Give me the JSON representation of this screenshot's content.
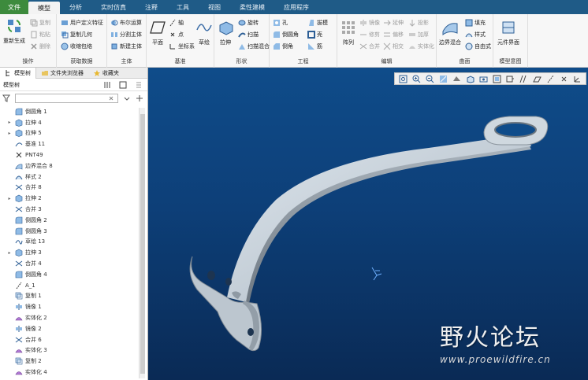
{
  "menu": [
    "文件",
    "模型",
    "分析",
    "实时仿真",
    "注释",
    "工具",
    "视图",
    "柔性建模",
    "应用程序"
  ],
  "ribbon": {
    "operations": {
      "regenerate": "重新生成",
      "copy": "复制",
      "paste": "粘贴",
      "delete": "删除",
      "label": "操作"
    },
    "get_data": {
      "udf": "用户定义特征",
      "copy_geom": "复制几何",
      "shrinkwrap": "收缩包络",
      "label": "获取数据"
    },
    "body": {
      "boolean": "布尔运算",
      "split": "分割主体",
      "new_body": "新建主体",
      "label": "主体"
    },
    "datum": {
      "plane": "平面",
      "axis": "轴",
      "point": "点",
      "csys": "坐标系",
      "sketch": "草绘",
      "label": "基准"
    },
    "shapes": {
      "extrude": "拉伸",
      "revolve": "旋转",
      "sweep": "扫描",
      "swept_blend": "扫描混合",
      "label": "形状"
    },
    "engineering": {
      "hole": "孔",
      "round": "倒圆角",
      "chamfer": "倒角",
      "draft": "拔模",
      "shell": "壳",
      "rib": "筋",
      "label": "工程"
    },
    "editing": {
      "pattern": "阵列",
      "mirror": "镜像",
      "trim": "修剪",
      "merge": "合并",
      "extend": "延伸",
      "offset": "偏移",
      "intersect": "相交",
      "thicken": "加厚",
      "project": "投影",
      "solidify": "实体化",
      "label": "编辑"
    },
    "surfaces": {
      "boundary_blend": "边界混合",
      "fill": "填充",
      "style": "样式",
      "freestyle": "自由式",
      "label": "曲面"
    },
    "model_intent": {
      "component_interface": "元件界面",
      "label": "模型意图"
    }
  },
  "panel": {
    "tabs": [
      "模型树",
      "文件夹浏览器",
      "收藏夹"
    ],
    "tree_title": "模型树",
    "search_placeholder": ""
  },
  "tree": [
    {
      "label": "倒圆角 1",
      "icon": "round-icon",
      "expandable": false
    },
    {
      "label": "拉伸 4",
      "icon": "extrude-icon",
      "expandable": true
    },
    {
      "label": "拉伸 5",
      "icon": "extrude-icon",
      "expandable": true
    },
    {
      "label": "基准 11",
      "icon": "datum-icon",
      "expandable": false
    },
    {
      "label": "PNT49",
      "icon": "point-icon",
      "expandable": false
    },
    {
      "label": "边界混合 8",
      "icon": "boundary-blend-icon",
      "expandable": false
    },
    {
      "label": "样式 2",
      "icon": "style-icon",
      "expandable": false
    },
    {
      "label": "合并 8",
      "icon": "merge-icon",
      "expandable": false
    },
    {
      "label": "拉伸 2",
      "icon": "extrude-icon",
      "expandable": true
    },
    {
      "label": "合并 3",
      "icon": "merge-icon",
      "expandable": false
    },
    {
      "label": "倒圆角 2",
      "icon": "round-icon",
      "expandable": false
    },
    {
      "label": "倒圆角 3",
      "icon": "round-icon",
      "expandable": false
    },
    {
      "label": "草绘 13",
      "icon": "sketch-icon",
      "expandable": false
    },
    {
      "label": "拉伸 3",
      "icon": "extrude-icon",
      "expandable": true
    },
    {
      "label": "合并 4",
      "icon": "merge-icon",
      "expandable": false
    },
    {
      "label": "倒圆角 4",
      "icon": "round-icon",
      "expandable": false
    },
    {
      "label": "A_1",
      "icon": "axis-icon",
      "expandable": false
    },
    {
      "label": "复制 1",
      "icon": "copy-icon",
      "expandable": false
    },
    {
      "label": "镜像 1",
      "icon": "mirror-icon",
      "expandable": false
    },
    {
      "label": "实体化 2",
      "icon": "solidify-icon",
      "expandable": false
    },
    {
      "label": "镜像 2",
      "icon": "mirror-icon",
      "expandable": false
    },
    {
      "label": "合并 6",
      "icon": "merge-icon",
      "expandable": false
    },
    {
      "label": "实体化 3",
      "icon": "solidify-icon",
      "expandable": false
    },
    {
      "label": "复制 2",
      "icon": "copy-icon",
      "expandable": false
    },
    {
      "label": "实体化 4",
      "icon": "solidify-icon",
      "expandable": false
    }
  ],
  "watermark": {
    "title": "野火论坛",
    "url": "www.proewildfire.cn"
  },
  "colors": {
    "menubar": "#1f5b87",
    "file_tab": "#3d8b3d",
    "viewport_top": "#0f4c8a",
    "viewport_bottom": "#0a2a55",
    "part": "#c9d3db"
  }
}
